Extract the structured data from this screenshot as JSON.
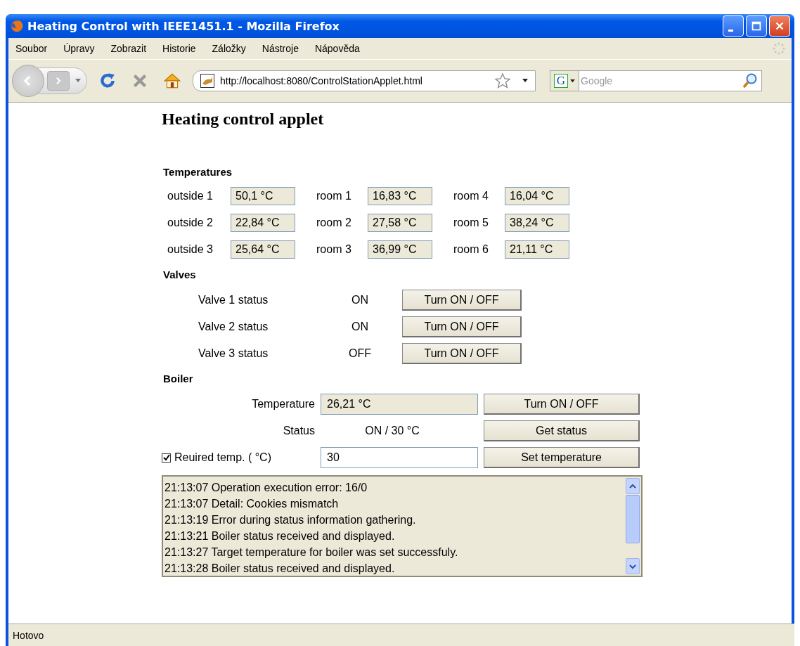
{
  "window": {
    "title": "Heating Control with IEEE1451.1 - Mozilla Firefox"
  },
  "menu": [
    "Soubor",
    "Úpravy",
    "Zobrazit",
    "Historie",
    "Záložky",
    "Nástroje",
    "Nápověda"
  ],
  "address_bar": {
    "value": "http://localhost:8080/ControlStationApplet.html"
  },
  "search": {
    "engine": "G",
    "placeholder": "Google"
  },
  "page": {
    "heading": "Heating control applet",
    "temperatures": {
      "title": "Temperatures",
      "sensors": [
        {
          "label": "outside 1",
          "value": "50,1 °C"
        },
        {
          "label": "room 1",
          "value": "16,83 °C"
        },
        {
          "label": "room 4",
          "value": "16,04 °C"
        },
        {
          "label": "outside 2",
          "value": "22,84 °C"
        },
        {
          "label": "room 2",
          "value": "27,58 °C"
        },
        {
          "label": "room 5",
          "value": "38,24 °C"
        },
        {
          "label": "outside 3",
          "value": "25,64 °C"
        },
        {
          "label": "room 3",
          "value": "36,99 °C"
        },
        {
          "label": "room 6",
          "value": "21,11 °C"
        }
      ]
    },
    "valves": {
      "title": "Valves",
      "items": [
        {
          "label": "Valve 1 status",
          "status": "ON",
          "button": "Turn ON / OFF"
        },
        {
          "label": "Valve 2 status",
          "status": "ON",
          "button": "Turn ON / OFF"
        },
        {
          "label": "Valve 3 status",
          "status": "OFF",
          "button": "Turn ON / OFF"
        }
      ]
    },
    "boiler": {
      "title": "Boiler",
      "temperature": {
        "label": "Temperature",
        "value": "26,21 °C",
        "button": "Turn ON / OFF"
      },
      "status": {
        "label": "Status",
        "value": "ON / 30 °C",
        "button": "Get status"
      },
      "required": {
        "label": "Reuired temp. ( °C)",
        "checked": true,
        "value": "30",
        "button": "Set temperature"
      }
    },
    "log": [
      "21:13:07 Operation execution error: 16/0",
      "21:13:07 Detail: Cookies mismatch",
      "21:13:19 Error during status information gathering.",
      "21:13:21 Boiler status received and displayed.",
      "21:13:27 Target temperature for boiler was set successfuly.",
      "21:13:28 Boiler status received and displayed."
    ]
  },
  "status_bar": {
    "text": "Hotovo"
  }
}
